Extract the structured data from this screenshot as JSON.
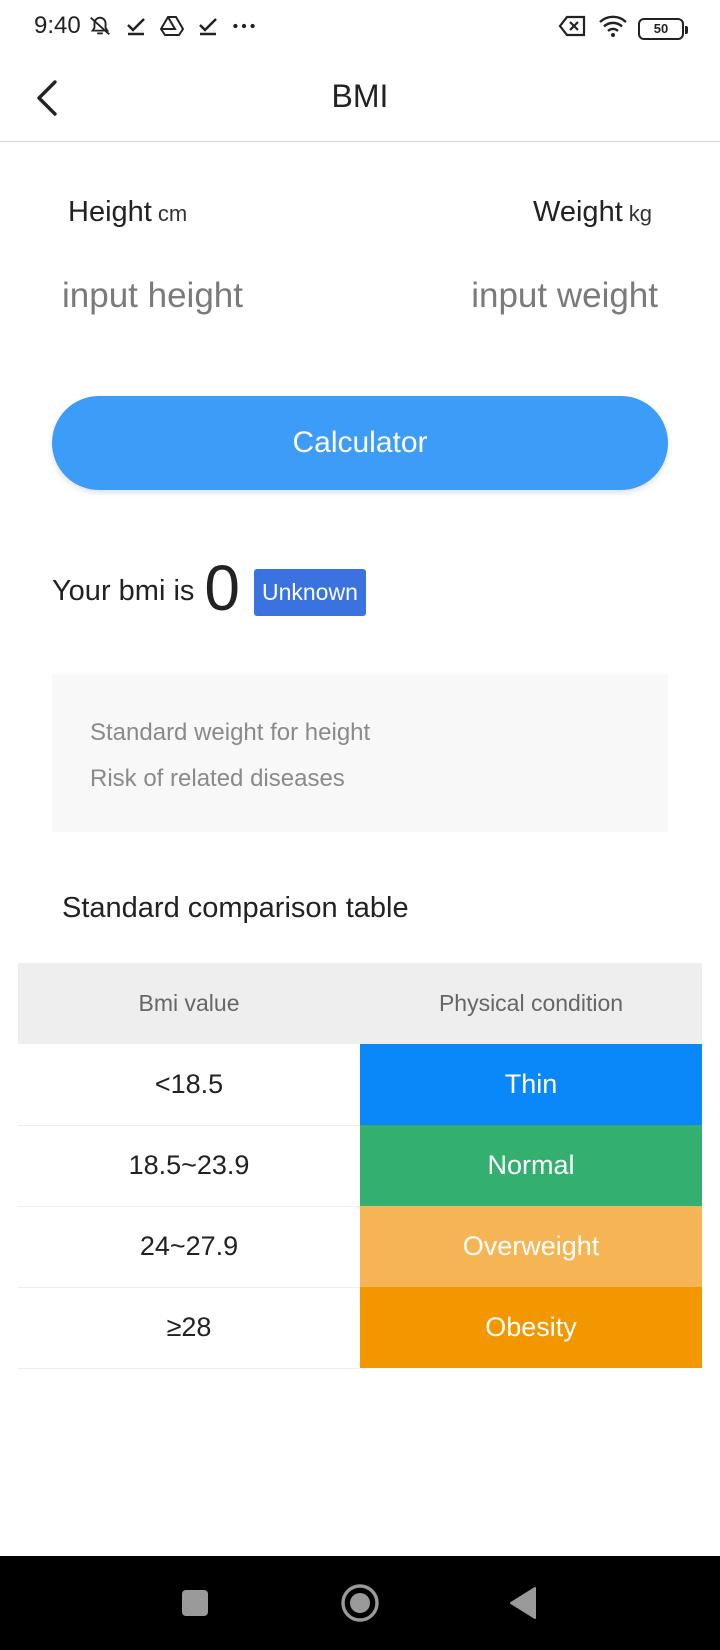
{
  "status_bar": {
    "time": "9:40",
    "battery": "50",
    "icons": [
      "mute-notification-icon",
      "check-icon",
      "drive-icon",
      "check-icon",
      "more-dots-icon",
      "sim-off-icon",
      "wifi-icon",
      "battery-icon"
    ]
  },
  "nav": {
    "title": "BMI",
    "back_icon": "chevron-left-icon"
  },
  "form": {
    "height_label": "Height",
    "height_unit": "cm",
    "weight_label": "Weight",
    "weight_unit": "kg",
    "height_placeholder": "input height",
    "weight_placeholder": "input weight",
    "height_value": "",
    "weight_value": "",
    "calculate_label": "Calculator"
  },
  "result": {
    "prefix": "Your bmi is",
    "value": "0",
    "status": "Unknown",
    "status_color": "#3a73e0"
  },
  "info": {
    "line1": "Standard weight for height",
    "line2": "Risk of related diseases"
  },
  "table": {
    "title": "Standard comparison table",
    "headers": [
      "Bmi value",
      "Physical condition"
    ],
    "rows": [
      {
        "value": "<18.5",
        "condition": "Thin",
        "color": "#0a87f8"
      },
      {
        "value": "18.5~23.9",
        "condition": "Normal",
        "color": "#33b06f"
      },
      {
        "value": "24~27.9",
        "condition": "Overweight",
        "color": "#f6b554"
      },
      {
        "value": "≥28",
        "condition": "Obesity",
        "color": "#f39700"
      }
    ]
  },
  "colors": {
    "accent": "#3d9cf7"
  },
  "system_nav": {
    "icons": [
      "recent-apps-icon",
      "home-icon",
      "back-icon"
    ]
  }
}
